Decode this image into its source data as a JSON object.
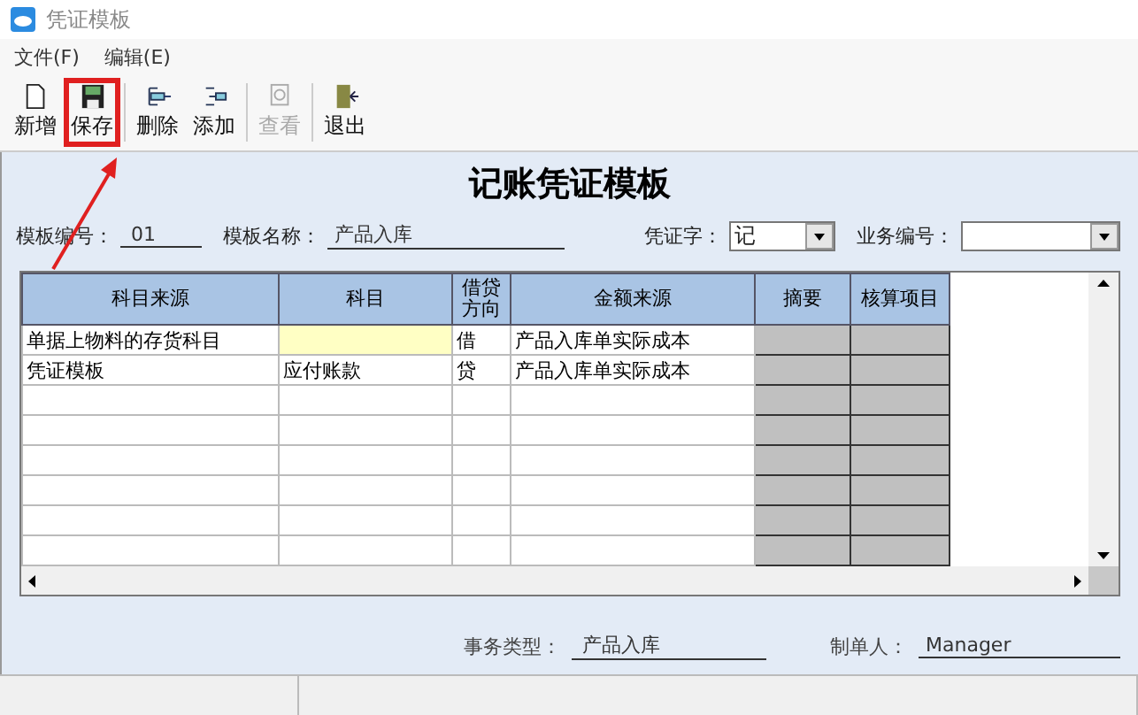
{
  "window": {
    "title": "凭证模板"
  },
  "menu": [
    "文件(F)",
    "编辑(E)"
  ],
  "toolbar": [
    {
      "label": "新增",
      "kind": "new",
      "disabled": false,
      "highlighted": false
    },
    {
      "label": "保存",
      "kind": "save",
      "disabled": false,
      "highlighted": true
    },
    {
      "label": "删除",
      "kind": "remove",
      "disabled": false,
      "highlighted": false
    },
    {
      "label": "添加",
      "kind": "add",
      "disabled": false,
      "highlighted": false
    },
    {
      "label": "查看",
      "kind": "view",
      "disabled": true,
      "highlighted": false
    },
    {
      "label": "退出",
      "kind": "exit",
      "disabled": false,
      "highlighted": false
    }
  ],
  "heading": "记账凭证模板",
  "fields": {
    "template_no": {
      "label": "模板编号：",
      "value": "01"
    },
    "template_name": {
      "label": "模板名称：",
      "value": "产品入库"
    },
    "voucher_word": {
      "label": "凭证字：",
      "value": "记"
    },
    "business_no": {
      "label": "业务编号："
    }
  },
  "table": {
    "columns": [
      "科目来源",
      "科目",
      "借贷方向",
      "金额来源",
      "摘要",
      "核算项目"
    ],
    "rows": [
      [
        "单据上物料的存货科目",
        "",
        "借",
        "产品入库单实际成本"
      ],
      [
        "凭证模板",
        "应付账款",
        "贷",
        "产品入库单实际成本"
      ],
      [
        "",
        "",
        "",
        ""
      ],
      [
        "",
        "",
        "",
        ""
      ],
      [
        "",
        "",
        "",
        ""
      ],
      [
        "",
        "",
        "",
        ""
      ],
      [
        "",
        "",
        "",
        ""
      ],
      [
        "",
        "",
        "",
        ""
      ]
    ]
  },
  "footer": {
    "business_type": {
      "label": "事务类型：",
      "value": "产品入库"
    },
    "maker": {
      "label": "制单人：",
      "value": "Manager"
    }
  }
}
